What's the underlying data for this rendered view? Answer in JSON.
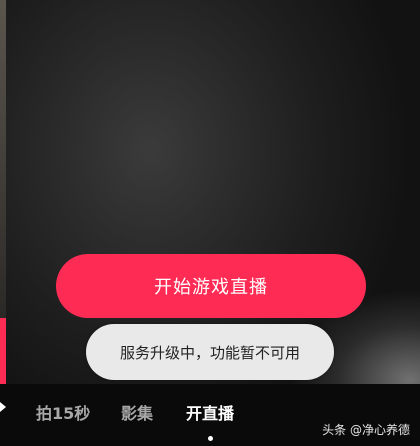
{
  "main": {
    "start_live_label": "开始游戏直播",
    "toast_message": "服务升级中，功能暂不可用"
  },
  "mode_tabs": [
    {
      "label": "拍15秒",
      "active": false
    },
    {
      "label": "影集",
      "active": false
    },
    {
      "label": "开直播",
      "active": true
    }
  ],
  "watermark": "头条 @净心养德",
  "colors": {
    "accent": "#fe2c55",
    "toast_bg": "#e9e9e9",
    "bottom_bar": "#0a0a0a"
  }
}
